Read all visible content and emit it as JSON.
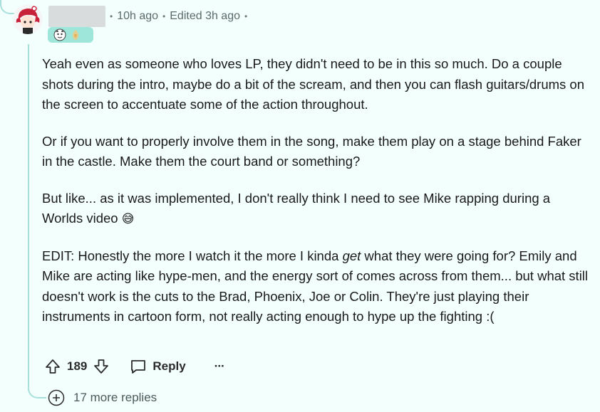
{
  "comment": {
    "time_ago": "10h ago",
    "edited": "Edited 3h ago",
    "separator": "•",
    "paragraphs": [
      "Yeah even as someone who loves LP, they didn't need to be in this so much. Do a couple shots during the intro, maybe do a bit of the scream, and then you can flash guitars/drums on the screen to accentuate some of the action throughout.",
      "Or if you want to properly involve them in the song, make them play on a stage behind Faker in the castle. Make them the court band or something?",
      "But like... as it was implemented, I don't really think I need to see Mike rapping during a Worlds video",
      "EDIT: Honestly the more I watch it the more I kinda ",
      "get",
      " what they were going for? Emily and Mike are acting like hype-men, and the energy sort of comes across from them... but what still doesn't work is the cuts to the Brad, Phoenix, Joe or Colin. They're just playing their instruments in cartoon form, not really acting enough to hype up the fighting :("
    ],
    "emoji": "😅",
    "score": "189",
    "reply_label": "Reply",
    "more_label": "···",
    "more_replies": "17 more replies"
  },
  "colors": {
    "background": "#f3fffd",
    "thread_line": "#a7e0da",
    "flair_bg": "#9fe6da"
  },
  "icons": [
    "user-avatar",
    "flair-icon",
    "upvote-icon",
    "downvote-icon",
    "comment-icon",
    "overflow-menu-icon",
    "plus-circle-icon"
  ]
}
